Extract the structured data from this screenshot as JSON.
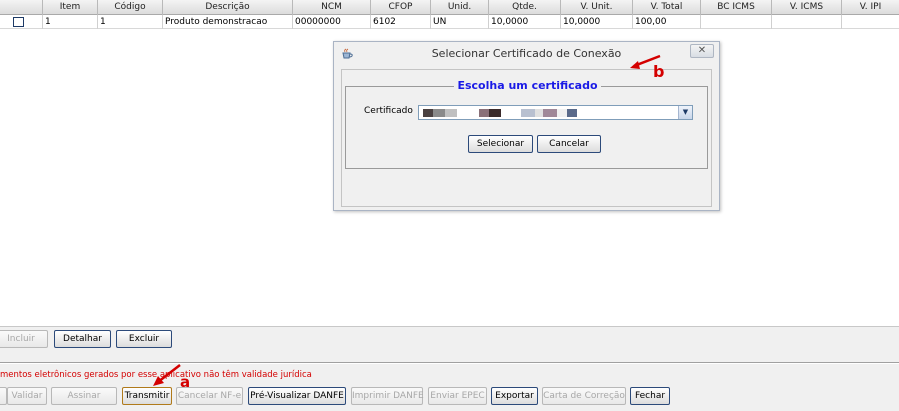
{
  "grid": {
    "columns": [
      "",
      "Item",
      "Código",
      "Descrição",
      "NCM",
      "CFOP",
      "Unid.",
      "Qtde.",
      "V. Unit.",
      "V. Total",
      "BC ICMS",
      "V. ICMS",
      "V. IPI"
    ],
    "row": {
      "item": "1",
      "codigo": "1",
      "descricao": "Produto demonstracao",
      "ncm": "00000000",
      "cfop": "6102",
      "unid": "UN",
      "qtde": "10,0000",
      "v_unit": "10,0000",
      "v_total": "100,00",
      "bc_icms": "",
      "v_icms": "",
      "v_ipi": ""
    }
  },
  "item_buttons": {
    "incluir": "Incluir",
    "detalhar": "Detalhar",
    "excluir": "Excluir"
  },
  "warning_text": "mentos eletrônicos gerados por esse aplicativo não têm validade jurídica",
  "action_buttons": {
    "validar": "Validar",
    "assinar": "Assinar",
    "transmitir": "Transmitir",
    "cancelar_nfe": "Cancelar NF-e",
    "pre_visualizar": "Pré-Visualizar DANFE",
    "imprimir": "Imprimir DANFE",
    "enviar_epec": "Enviar EPEC",
    "exportar": "Exportar",
    "carta_correcao": "Carta de Correção",
    "fechar": "Fechar"
  },
  "dialog": {
    "title": "Selecionar Certificado de Conexão",
    "legend": "Escolha um certificado",
    "certificado_label": "Certificado",
    "certificado_value_colors": [
      "#4a4040",
      "#8a8a8a",
      "#c0c0c0",
      "#ffffff",
      "#8a7078",
      "#3a2a2a",
      "#ffffff",
      "#b8c0d0",
      "#e0e0e0",
      "#a08898",
      "#f0f0f0",
      "#5a6a8a"
    ],
    "selecionar": "Selecionar",
    "cancelar": "Cancelar",
    "close_glyph": "✕"
  },
  "annotations": {
    "a": "a",
    "b": "b"
  }
}
